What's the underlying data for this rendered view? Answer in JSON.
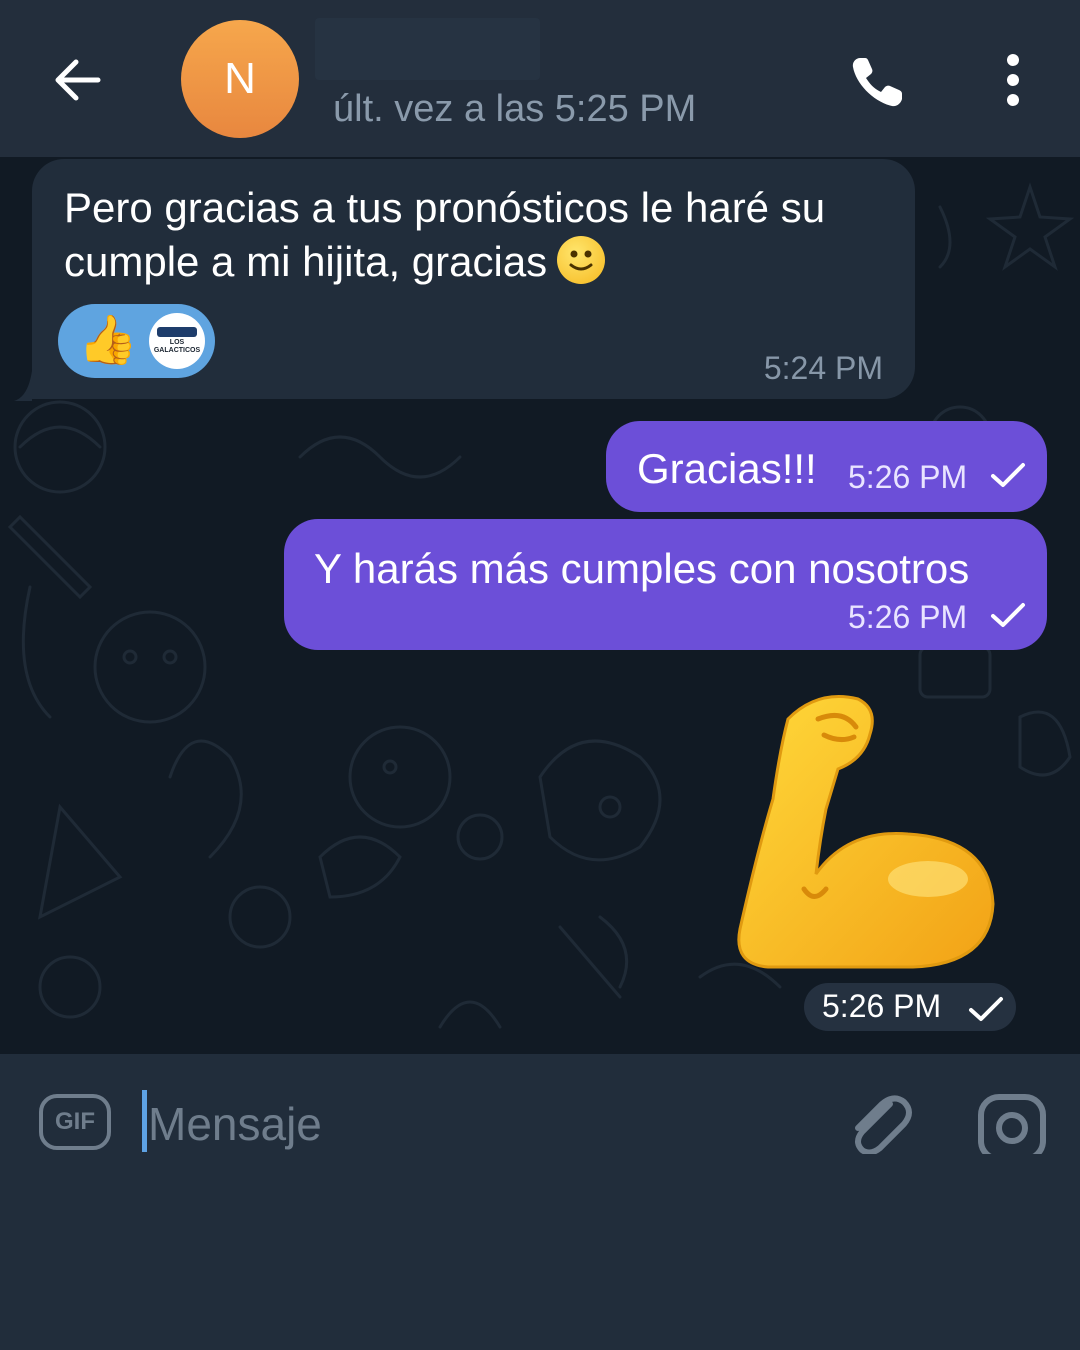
{
  "header": {
    "back_icon": "arrow-left-icon",
    "avatar_initial": "N",
    "avatar_colors": [
      "#f6a74c",
      "#e8873f"
    ],
    "last_seen": "últ. vez a las 5:25 PM",
    "call_icon": "phone-icon",
    "menu_icon": "more-vertical-icon"
  },
  "messages": [
    {
      "direction": "incoming",
      "text": "Pero gracias a tus pronósticos le haré su cumple a mi hijita,  gracias",
      "trailing_emoji": "slightly-smiling-face",
      "time": "5:24 PM",
      "reactions": [
        {
          "emoji": "👍",
          "name": "thumbs-up"
        },
        {
          "name": "los-galacticos-logo",
          "logo_text": "LOS GALACTICOS"
        }
      ]
    },
    {
      "direction": "outgoing",
      "text": "Gracias!!!",
      "time": "5:26 PM",
      "status": "sent-check"
    },
    {
      "direction": "outgoing",
      "text": "Y harás más cumples con nosotros",
      "time": "5:26 PM",
      "status": "sent-check"
    },
    {
      "direction": "outgoing",
      "type": "sticker",
      "sticker": "flexed-biceps",
      "time": "5:26 PM",
      "status": "sent-check"
    }
  ],
  "input": {
    "gif_label": "GIF",
    "placeholder": "Mensaje",
    "attach_icon": "paperclip-icon",
    "camera_icon": "camera-icon"
  },
  "colors": {
    "header_bg": "#232e3c",
    "chat_bg": "#111a24",
    "incoming_bubble": "#212d3b",
    "outgoing_bubble": "#6c4fd8",
    "reaction_bg": "#5fa4e0",
    "cursor": "#5ea2e4"
  }
}
